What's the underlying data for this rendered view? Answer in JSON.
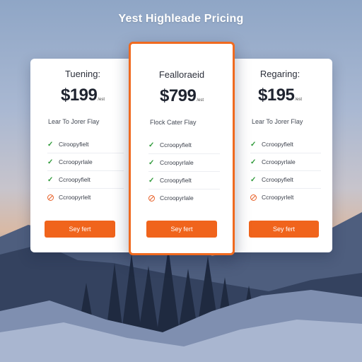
{
  "page": {
    "title": "Yest Highleade Pricing"
  },
  "colors": {
    "accent": "#f0641c",
    "check": "#2f9a3a",
    "card": "#ffffff"
  },
  "plans": [
    {
      "name": "Tuening:",
      "price": "$199",
      "per": "/est",
      "tagline": "Lear To Jorer Flay",
      "features": [
        {
          "icon": "check-icon",
          "label": "Ciroopyfielt"
        },
        {
          "icon": "check-icon",
          "label": "Ccroopyrlale"
        },
        {
          "icon": "check-icon",
          "label": "Ccroopyfielt"
        },
        {
          "icon": "cross-icon",
          "label": "Ccroopyrlelt"
        }
      ],
      "cta": "Sey fert"
    },
    {
      "name": "Fealloraeid",
      "price": "$799",
      "per": "/est",
      "tagline": "Flock Cater Flay",
      "features": [
        {
          "icon": "check-icon",
          "label": "Ccroopyfielt"
        },
        {
          "icon": "check-icon",
          "label": "Ccroopyrlale"
        },
        {
          "icon": "check-icon",
          "label": "Ccroopyfielt"
        },
        {
          "icon": "cross-icon",
          "label": "Ccroopyrlale"
        }
      ],
      "cta": "Sey fert"
    },
    {
      "name": "Regaring:",
      "price": "$195",
      "per": "/est",
      "tagline": "Lear To Jorer Flay",
      "features": [
        {
          "icon": "check-icon",
          "label": "Ccroopyfielt"
        },
        {
          "icon": "check-icon",
          "label": "Ccroopyrlale"
        },
        {
          "icon": "check-icon",
          "label": "Ccroopyfielt"
        },
        {
          "icon": "cross-icon",
          "label": "Ccroopyrlelt"
        }
      ],
      "cta": "Sey fert"
    }
  ]
}
